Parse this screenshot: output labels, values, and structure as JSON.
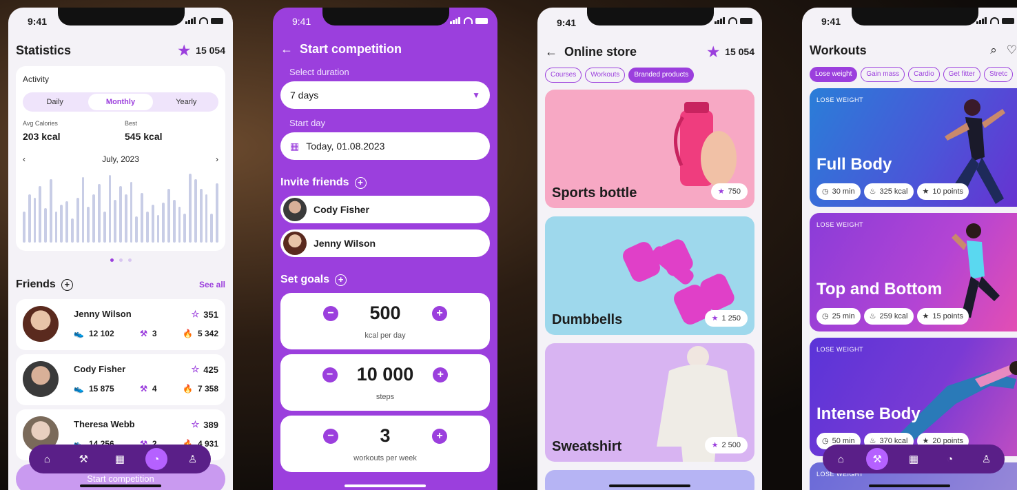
{
  "colors": {
    "accent": "#9B3FDD",
    "nav": "#5A1F88",
    "background": "#F4F2F7"
  },
  "status_time": "9:41",
  "statistics": {
    "title": "Statistics",
    "points": "15 054",
    "activity_label": "Activity",
    "tabs": [
      "Daily",
      "Monthly",
      "Yearly"
    ],
    "active_tab": "Monthly",
    "avg_label": "Avg Calories",
    "avg_value": "203 kcal",
    "best_label": "Best",
    "best_value": "545 kcal",
    "month": "July, 2023",
    "bar_levels": [
      0.45,
      0.7,
      0.65,
      0.82,
      0.5,
      0.92,
      0.45,
      0.55,
      0.6,
      0.35,
      0.65,
      0.95,
      0.52,
      0.7,
      0.85,
      0.45,
      0.98,
      0.62,
      0.82,
      0.7,
      0.88,
      0.38,
      0.72,
      0.45,
      0.55,
      0.4,
      0.58,
      0.78,
      0.62,
      0.52,
      0.42,
      1.0,
      0.92,
      0.78,
      0.7,
      0.42,
      0.86
    ],
    "page_dots": 3,
    "friends_title": "Friends",
    "see_all": "See all",
    "friends": [
      {
        "name": "Jenny Wilson",
        "stars": "351",
        "steps": "12 102",
        "workouts": "3",
        "kcal": "5 342"
      },
      {
        "name": "Cody Fisher",
        "stars": "425",
        "steps": "15 875",
        "workouts": "4",
        "kcal": "7 358"
      },
      {
        "name": "Theresa Webb",
        "stars": "389",
        "steps": "14 256",
        "workouts": "2",
        "kcal": "4 931"
      }
    ],
    "start_button": "Start competition"
  },
  "competition": {
    "title": "Start competition",
    "duration_label": "Select duration",
    "duration_value": "7 days",
    "start_label": "Start day",
    "start_value": "Today, 01.08.2023",
    "invite_title": "Invite friends",
    "invited": [
      "Cody Fisher",
      "Jenny Wilson"
    ],
    "goals_title": "Set goals",
    "goals": [
      {
        "value": "500",
        "unit": "kcal per day"
      },
      {
        "value": "10 000",
        "unit": "steps"
      },
      {
        "value": "3",
        "unit": "workouts per week"
      }
    ]
  },
  "store": {
    "title": "Online store",
    "points": "15 054",
    "chips": [
      "Courses",
      "Workouts",
      "Branded products"
    ],
    "active_chip": "Branded products",
    "products": [
      {
        "name": "Sports bottle",
        "price": "750",
        "color": "#F7A8C4"
      },
      {
        "name": "Dumbbells",
        "price": "1 250",
        "color": "#9ED8EC"
      },
      {
        "name": "Sweatshirt",
        "price": "2 500",
        "color": "#D8B4F2"
      }
    ]
  },
  "workouts": {
    "title": "Workouts",
    "chips": [
      "Lose weight",
      "Gain mass",
      "Cardio",
      "Get fitter",
      "Stretc"
    ],
    "active_chip": "Lose weight",
    "cards": [
      {
        "tag": "LOSE WEIGHT",
        "name": "Full Body",
        "time": "30 min",
        "kcal": "325 kcal",
        "points": "10 points"
      },
      {
        "tag": "LOSE WEIGHT",
        "name": "Top and Bottom",
        "time": "25 min",
        "kcal": "259 kcal",
        "points": "15 points"
      },
      {
        "tag": "LOSE WEIGHT",
        "name": "Intense Body",
        "time": "50 min",
        "kcal": "370 kcal",
        "points": "20 points"
      },
      {
        "tag": "LOSE WEIGHT"
      }
    ]
  }
}
